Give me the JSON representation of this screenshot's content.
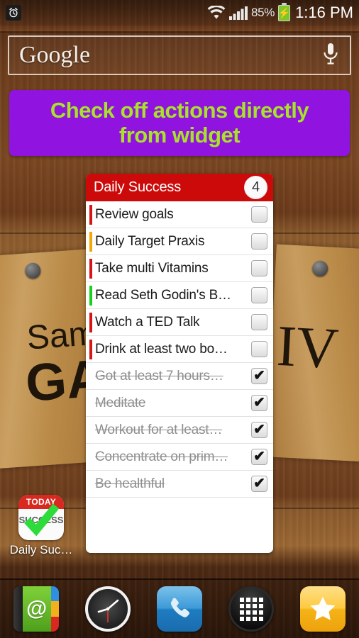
{
  "status_bar": {
    "alarm_icon": "alarm-clock-icon",
    "wifi_icon": "wifi-icon",
    "signal_icon": "signal-bars-icon",
    "battery_percent": "85%",
    "battery_icon": "battery-charging-icon",
    "time": "1:16 PM"
  },
  "search": {
    "brand": "Google",
    "mic_icon": "microphone-icon"
  },
  "banner": {
    "line1": "Check off actions directly",
    "line2": "from widget",
    "background_color": "#9013e0",
    "text_color": "#a8e32a"
  },
  "wallpaper": {
    "left_text_top": "Sam",
    "left_text_bottom": "GA",
    "right_text": "IV"
  },
  "widget": {
    "title": "Daily Success",
    "count_badge": "4",
    "header_color": "#cc0a0a",
    "tasks": [
      {
        "label": "Review goals",
        "done": false,
        "color": "#d81414"
      },
      {
        "label": "Daily Target Praxis",
        "done": false,
        "color": "#f5a800"
      },
      {
        "label": "Take multi Vitamins",
        "done": false,
        "color": "#d81414"
      },
      {
        "label": "Read Seth Godin's B…",
        "done": false,
        "color": "#17d11c"
      },
      {
        "label": "Watch a TED Talk",
        "done": false,
        "color": "#d81414"
      },
      {
        "label": "Drink at least two bo…",
        "done": false,
        "color": "#d81414"
      },
      {
        "label": "Got at least 7 hours…",
        "done": true,
        "color": ""
      },
      {
        "label": "Meditate",
        "done": true,
        "color": ""
      },
      {
        "label": "Workout for at least…",
        "done": true,
        "color": ""
      },
      {
        "label": "Concentrate on prim…",
        "done": true,
        "color": ""
      },
      {
        "label": "Be healthful",
        "done": true,
        "color": ""
      }
    ],
    "checkmark_glyph": "✔"
  },
  "app_shortcut": {
    "icon_top_text": "TODAY",
    "icon_body_text": "SUCCESS",
    "label": "Daily Suc…"
  },
  "dock": {
    "items": [
      {
        "name": "contacts",
        "glyph": "@"
      },
      {
        "name": "clock",
        "glyph": ""
      },
      {
        "name": "phone",
        "glyph": ""
      },
      {
        "name": "app-drawer",
        "glyph": ""
      },
      {
        "name": "favorites",
        "glyph": ""
      }
    ]
  }
}
